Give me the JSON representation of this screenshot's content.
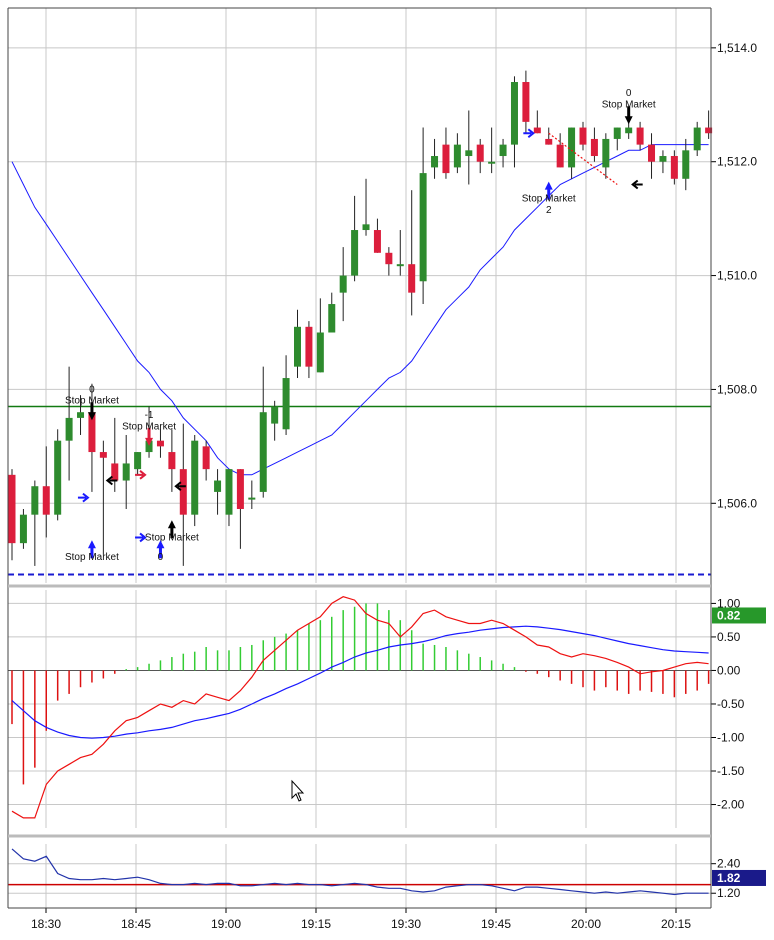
{
  "colors": {
    "up": "#2e8b2e",
    "down": "#dc1e3c",
    "ma": "#1a1aff",
    "support": "#1a1ad0",
    "level": "#127a12",
    "grid": "#c8c8c8",
    "hist_up": "#33cc33",
    "hist_down": "#dd1111",
    "signal": "#ee1111",
    "macd_badge": "#27982a",
    "ind2_line": "#2233aa",
    "ind2_ref": "#cc0000",
    "ind2_badge": "#1a1a8a"
  },
  "chart_data": [
    {
      "type": "candlestick",
      "panel": "price",
      "title": "",
      "ylim": [
        1504.6,
        1514.7
      ],
      "y_ticks": [
        "1,514.0",
        "1,512.0",
        "1,510.0",
        "1,508.0",
        "1,506.0"
      ],
      "y_tick_values": [
        1514,
        1512,
        1510,
        1508,
        1506
      ],
      "x_ticks": [
        "18:30",
        "18:45",
        "19:00",
        "19:15",
        "19:30",
        "19:45",
        "20:00",
        "20:15"
      ],
      "x_tick_bars": [
        3,
        13,
        18,
        24,
        32,
        40,
        48,
        56
      ],
      "grid": true,
      "candles": [
        [
          1506.5,
          1506.6,
          1505.0,
          1505.3
        ],
        [
          1505.3,
          1505.9,
          1505.2,
          1505.8
        ],
        [
          1505.8,
          1506.4,
          1504.9,
          1506.3
        ],
        [
          1506.3,
          1507.0,
          1505.4,
          1505.8
        ],
        [
          1505.8,
          1507.3,
          1505.7,
          1507.1
        ],
        [
          1507.1,
          1508.4,
          1506.4,
          1507.5
        ],
        [
          1507.5,
          1507.9,
          1507.2,
          1507.6
        ],
        [
          1507.6,
          1508.1,
          1506.2,
          1506.9
        ],
        [
          1506.9,
          1507.1,
          1505.1,
          1506.8
        ],
        [
          1506.7,
          1507.5,
          1506.2,
          1506.4
        ],
        [
          1506.4,
          1507.2,
          1505.9,
          1506.7
        ],
        [
          1506.6,
          1506.9,
          1506.5,
          1506.9
        ],
        [
          1506.9,
          1507.7,
          1506.8,
          1507.1
        ],
        [
          1507.1,
          1507.3,
          1506.8,
          1507.0
        ],
        [
          1506.9,
          1507.3,
          1506.2,
          1506.6
        ],
        [
          1506.6,
          1507.4,
          1504.9,
          1505.8
        ],
        [
          1505.8,
          1507.2,
          1505.6,
          1507.1
        ],
        [
          1507.0,
          1507.1,
          1506.4,
          1506.6
        ],
        [
          1506.2,
          1506.6,
          1505.8,
          1506.4
        ],
        [
          1505.8,
          1506.6,
          1505.6,
          1506.6
        ],
        [
          1506.6,
          1506.6,
          1505.2,
          1505.9
        ],
        [
          1506.1,
          1506.4,
          1505.9,
          1506.1
        ],
        [
          1506.2,
          1508.4,
          1506.1,
          1507.6
        ],
        [
          1507.4,
          1507.8,
          1507.1,
          1507.7
        ],
        [
          1507.3,
          1508.6,
          1507.2,
          1508.2
        ],
        [
          1508.4,
          1509.4,
          1508.2,
          1509.1
        ],
        [
          1509.1,
          1509.2,
          1508.2,
          1508.4
        ],
        [
          1508.3,
          1509.6,
          1508.3,
          1509.0
        ],
        [
          1509.0,
          1509.7,
          1509.0,
          1509.5
        ],
        [
          1509.7,
          1510.5,
          1509.2,
          1510.0
        ],
        [
          1510.0,
          1511.4,
          1509.9,
          1510.8
        ],
        [
          1510.8,
          1511.7,
          1510.7,
          1510.9
        ],
        [
          1510.8,
          1511.0,
          1510.4,
          1510.4
        ],
        [
          1510.4,
          1510.5,
          1510.0,
          1510.2
        ],
        [
          1510.2,
          1510.8,
          1510.0,
          1510.2
        ],
        [
          1510.2,
          1511.5,
          1509.3,
          1509.7
        ],
        [
          1509.9,
          1512.6,
          1509.5,
          1511.8
        ],
        [
          1511.9,
          1512.4,
          1511.7,
          1512.1
        ],
        [
          1512.3,
          1512.6,
          1511.7,
          1511.8
        ],
        [
          1511.9,
          1512.5,
          1511.8,
          1512.3
        ],
        [
          1512.1,
          1512.9,
          1511.6,
          1512.2
        ],
        [
          1512.3,
          1512.4,
          1511.8,
          1512.0
        ],
        [
          1512.0,
          1512.6,
          1511.8,
          1512.0
        ],
        [
          1512.1,
          1512.4,
          1511.9,
          1512.3
        ],
        [
          1512.3,
          1513.5,
          1511.9,
          1513.4
        ],
        [
          1513.4,
          1513.6,
          1512.5,
          1512.7
        ],
        [
          1512.6,
          1512.9,
          1512.5,
          1512.5
        ],
        [
          1512.4,
          1512.6,
          1512.3,
          1512.3
        ],
        [
          1512.3,
          1512.5,
          1511.9,
          1511.9
        ],
        [
          1511.9,
          1512.6,
          1511.7,
          1512.6
        ],
        [
          1512.6,
          1512.7,
          1512.2,
          1512.3
        ],
        [
          1512.4,
          1512.6,
          1512.0,
          1512.1
        ],
        [
          1511.9,
          1512.5,
          1511.7,
          1512.4
        ],
        [
          1512.4,
          1512.6,
          1512.2,
          1512.6
        ],
        [
          1512.5,
          1512.7,
          1512.4,
          1512.6
        ],
        [
          1512.6,
          1512.7,
          1512.2,
          1512.3
        ],
        [
          1512.3,
          1512.5,
          1511.7,
          1512.0
        ],
        [
          1512.0,
          1512.2,
          1511.8,
          1512.1
        ],
        [
          1512.1,
          1512.2,
          1511.6,
          1511.7
        ],
        [
          1511.7,
          1512.4,
          1511.5,
          1512.2
        ],
        [
          1512.2,
          1512.7,
          1512.1,
          1512.6
        ],
        [
          1512.6,
          1512.9,
          1512.4,
          1512.5
        ]
      ],
      "moving_average": [
        1512.0,
        1511.6,
        1511.2,
        1510.9,
        1510.6,
        1510.3,
        1510.0,
        1509.7,
        1509.4,
        1509.1,
        1508.8,
        1508.5,
        1508.3,
        1508.0,
        1507.8,
        1507.5,
        1507.3,
        1507.1,
        1506.8,
        1506.6,
        1506.5,
        1506.5,
        1506.6,
        1506.7,
        1506.8,
        1506.9,
        1507.0,
        1507.1,
        1507.2,
        1507.4,
        1507.6,
        1507.8,
        1508.0,
        1508.2,
        1508.3,
        1508.5,
        1508.8,
        1509.1,
        1509.4,
        1509.6,
        1509.8,
        1510.1,
        1510.3,
        1510.5,
        1510.8,
        1511.0,
        1511.2,
        1511.4,
        1511.6,
        1511.7,
        1511.8,
        1511.9,
        1512.0,
        1512.1,
        1512.2,
        1512.2,
        1512.3,
        1512.3,
        1512.3,
        1512.3,
        1512.3,
        1512.3
      ],
      "horizontal_lines": [
        {
          "value": 1507.7,
          "style": "solid",
          "color_key": "level"
        },
        {
          "value": 1504.75,
          "style": "dashed",
          "color_key": "support"
        }
      ],
      "annotations": [
        {
          "bar": 7,
          "price": 1507.95,
          "text": "0",
          "dir": "down",
          "color": "#000000"
        },
        {
          "bar": 7,
          "price": 1507.75,
          "text": "Stop Market",
          "dir": "none",
          "color": "#000000"
        },
        {
          "bar": 7,
          "price": 1505.0,
          "text": "Stop Market",
          "dir": "up",
          "color": "#1a1aff"
        },
        {
          "bar": 12,
          "price": 1507.5,
          "text": "-1",
          "dir": "down",
          "color": "#dc1e3c"
        },
        {
          "bar": 12,
          "price": 1507.3,
          "text": "Stop Market",
          "dir": "none",
          "color": "#000000"
        },
        {
          "bar": 14,
          "price": 1505.35,
          "text": "Stop Market",
          "dir": "up",
          "color": "#000000"
        },
        {
          "bar": 13,
          "price": 1505.0,
          "text": "0",
          "dir": "up",
          "color": "#1a1aff"
        },
        {
          "bar": 54,
          "price": 1513.15,
          "text": "0",
          "dir": "down",
          "color": "#000000"
        },
        {
          "bar": 54,
          "price": 1512.95,
          "text": "Stop Market",
          "dir": "none",
          "color": "#000000"
        },
        {
          "bar": 47,
          "price": 1511.3,
          "text": "Stop Market",
          "dir": "up",
          "color": "#1a1aff"
        },
        {
          "bar": 47,
          "price": 1511.1,
          "text": "2",
          "dir": "none",
          "color": "#000000"
        }
      ],
      "trade_arrows": [
        {
          "bar": 7,
          "price": 1506.1,
          "side": "in-right",
          "color": "#1a1aff"
        },
        {
          "bar": 8,
          "price": 1506.4,
          "side": "in-left",
          "color": "#000000"
        },
        {
          "bar": 12,
          "price": 1506.5,
          "side": "in-right",
          "color": "#dc1e3c"
        },
        {
          "bar": 12,
          "price": 1505.4,
          "side": "in-right",
          "color": "#1a1aff"
        },
        {
          "bar": 14,
          "price": 1506.3,
          "side": "in-left",
          "color": "#000000"
        },
        {
          "bar": 46,
          "price": 1512.5,
          "side": "in-right",
          "color": "#1a1aff"
        },
        {
          "bar": 54,
          "price": 1511.6,
          "side": "in-left",
          "color": "#000000"
        }
      ],
      "trade_lines": [
        {
          "from_bar": 47,
          "from_price": 1512.5,
          "to_bar": 53,
          "to_price": 1511.6,
          "color": "#ee1111"
        }
      ]
    },
    {
      "type": "macd",
      "panel": "macd",
      "ylim": [
        -2.35,
        1.2
      ],
      "y_ticks": [
        "1.00",
        "0.50",
        "0.00",
        "-0.50",
        "-1.00",
        "-1.50",
        "-2.00"
      ],
      "y_tick_values": [
        1.0,
        0.5,
        0.0,
        -0.5,
        -1.0,
        -1.5,
        -2.0
      ],
      "current_value": "0.82",
      "current_level": 0.82,
      "histogram": [
        -0.8,
        -1.7,
        -1.45,
        -0.9,
        -0.45,
        -0.35,
        -0.25,
        -0.18,
        -0.12,
        -0.05,
        0.02,
        0.05,
        0.1,
        0.15,
        0.2,
        0.25,
        0.28,
        0.35,
        0.3,
        0.3,
        0.35,
        0.38,
        0.45,
        0.5,
        0.55,
        0.6,
        0.7,
        0.75,
        0.8,
        0.9,
        0.95,
        1.0,
        1.0,
        0.9,
        0.75,
        0.6,
        0.4,
        0.38,
        0.35,
        0.3,
        0.25,
        0.2,
        0.15,
        0.1,
        0.05,
        -0.02,
        -0.05,
        -0.1,
        -0.15,
        -0.2,
        -0.25,
        -0.3,
        -0.25,
        -0.3,
        -0.35,
        -0.3,
        -0.32,
        -0.35,
        -0.4,
        -0.35,
        -0.3,
        -0.2
      ],
      "macd_line": [
        -0.45,
        -0.6,
        -0.75,
        -0.85,
        -0.92,
        -0.97,
        -1.0,
        -1.01,
        -1.0,
        -0.98,
        -0.95,
        -0.93,
        -0.9,
        -0.88,
        -0.85,
        -0.8,
        -0.75,
        -0.72,
        -0.68,
        -0.64,
        -0.58,
        -0.5,
        -0.42,
        -0.35,
        -0.27,
        -0.2,
        -0.12,
        -0.04,
        0.05,
        0.12,
        0.2,
        0.26,
        0.3,
        0.35,
        0.38,
        0.4,
        0.43,
        0.47,
        0.52,
        0.55,
        0.57,
        0.6,
        0.62,
        0.64,
        0.65,
        0.66,
        0.65,
        0.63,
        0.61,
        0.58,
        0.55,
        0.52,
        0.48,
        0.44,
        0.4,
        0.37,
        0.34,
        0.31,
        0.29,
        0.28,
        0.27,
        0.26
      ],
      "signal_line": [
        -2.1,
        -2.2,
        -2.2,
        -1.7,
        -1.5,
        -1.4,
        -1.3,
        -1.25,
        -1.1,
        -0.9,
        -0.75,
        -0.7,
        -0.6,
        -0.5,
        -0.55,
        -0.45,
        -0.5,
        -0.35,
        -0.4,
        -0.45,
        -0.3,
        -0.1,
        0.15,
        0.3,
        0.45,
        0.6,
        0.7,
        0.8,
        1.0,
        1.1,
        1.05,
        0.85,
        0.75,
        0.7,
        0.5,
        0.65,
        0.85,
        0.9,
        0.8,
        0.75,
        0.7,
        0.7,
        0.75,
        0.7,
        0.6,
        0.5,
        0.38,
        0.35,
        0.25,
        0.2,
        0.25,
        0.22,
        0.18,
        0.12,
        0.05,
        -0.05,
        -0.02,
        0.0,
        0.05,
        0.1,
        0.12,
        0.1
      ]
    },
    {
      "type": "line",
      "panel": "indicator",
      "ylim": [
        0.6,
        3.2
      ],
      "y_ticks": [
        "2.40",
        "1.20"
      ],
      "y_tick_values": [
        2.4,
        1.2
      ],
      "current_value": "1.82",
      "current_level": 1.82,
      "reference_line": 1.55,
      "values": [
        3.0,
        2.6,
        2.5,
        2.7,
        2.0,
        1.8,
        1.75,
        1.75,
        1.8,
        1.75,
        1.8,
        1.85,
        1.75,
        1.6,
        1.55,
        1.55,
        1.6,
        1.55,
        1.6,
        1.6,
        1.5,
        1.5,
        1.55,
        1.6,
        1.55,
        1.6,
        1.55,
        1.55,
        1.5,
        1.55,
        1.6,
        1.55,
        1.45,
        1.4,
        1.4,
        1.3,
        1.25,
        1.3,
        1.45,
        1.5,
        1.55,
        1.55,
        1.5,
        1.4,
        1.3,
        1.45,
        1.45,
        1.4,
        1.35,
        1.3,
        1.25,
        1.2,
        1.25,
        1.2,
        1.25,
        1.3,
        1.25,
        1.2,
        1.15,
        1.2,
        1.2,
        1.2
      ]
    }
  ]
}
